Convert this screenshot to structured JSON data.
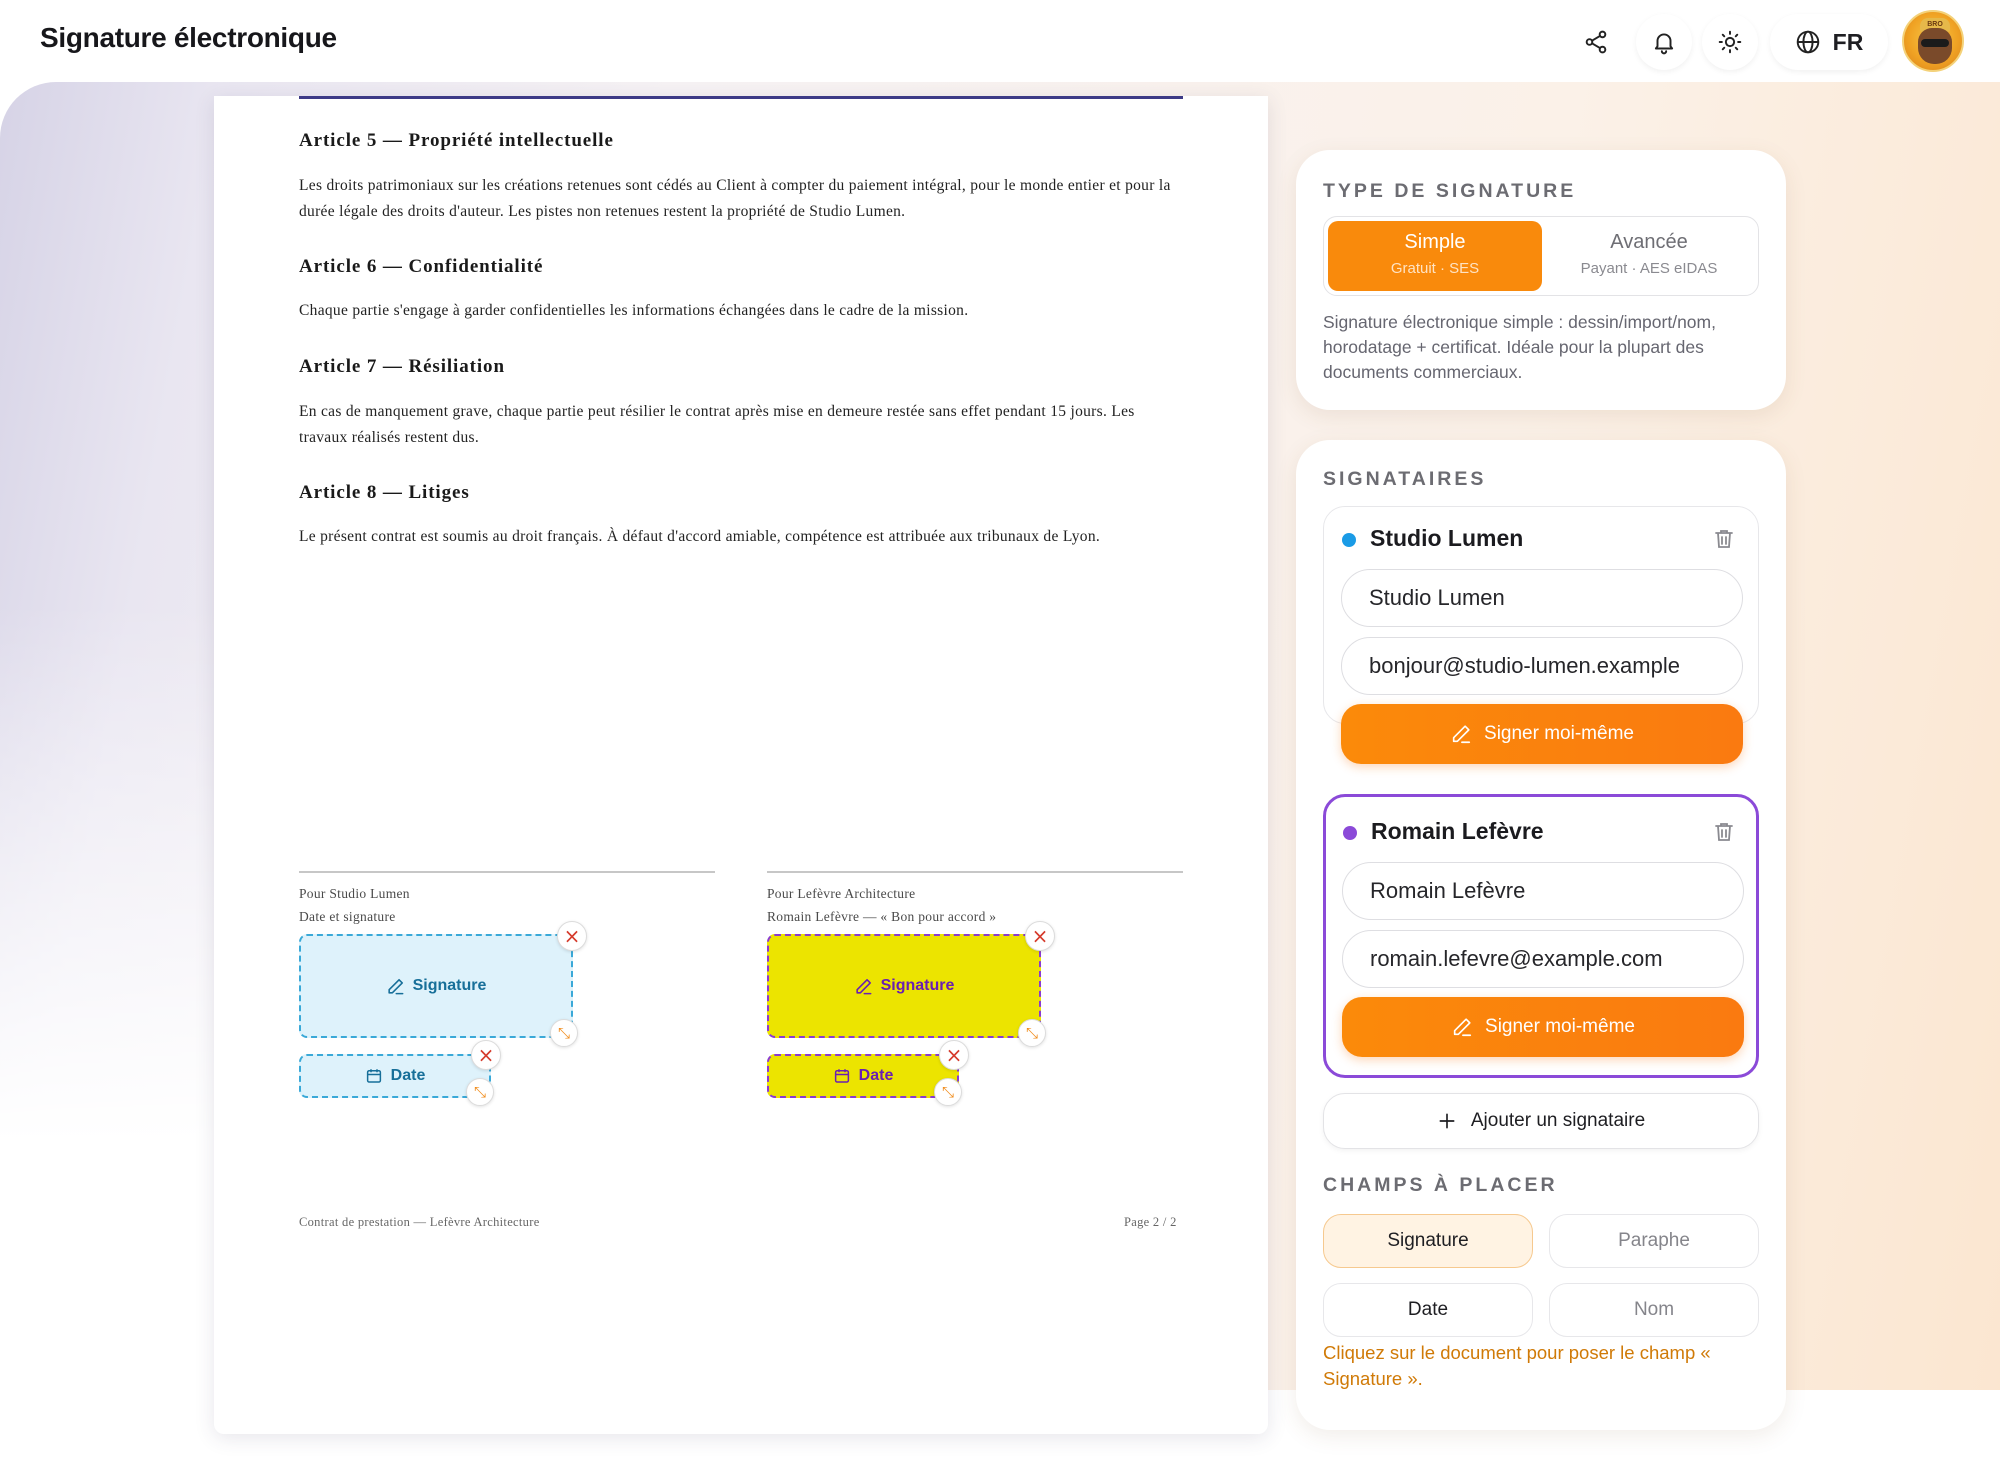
{
  "header": {
    "title": "Signature électronique",
    "language": "FR",
    "avatar_text": "BRO"
  },
  "document": {
    "articles": [
      {
        "title": "Article 5 — Propriété intellectuelle",
        "body": "Les droits patrimoniaux sur les créations retenues sont cédés au Client à compter du paiement intégral, pour le monde entier et pour la durée légale des droits d'auteur. Les pistes non retenues restent la propriété de Studio Lumen."
      },
      {
        "title": "Article 6 — Confidentialité",
        "body": "Chaque partie s'engage à garder confidentielles les informations échangées dans le cadre de la mission."
      },
      {
        "title": "Article 7 — Résiliation",
        "body": "En cas de manquement grave, chaque partie peut résilier le contrat après mise en demeure restée sans effet pendant 15 jours. Les travaux réalisés restent dus."
      },
      {
        "title": "Article 8 — Litiges",
        "body": "Le présent contrat est soumis au droit français. À défaut d'accord amiable, compétence est attribuée aux tribunaux de Lyon."
      }
    ],
    "signature_blocks": [
      {
        "line1": "Pour Studio Lumen",
        "line2": "Date et signature",
        "signature_label": "Signature",
        "date_label": "Date",
        "color": "#3aa9d8"
      },
      {
        "line1": "Pour Lefèvre Architecture",
        "line2": "Romain Lefèvre — « Bon pour accord »",
        "signature_label": "Signature",
        "date_label": "Date",
        "color": "#8a3bd0"
      }
    ],
    "footer_left": "Contrat de prestation — Lefèvre Architecture",
    "footer_right": "Page 2 / 2"
  },
  "signature_type": {
    "heading": "TYPE DE SIGNATURE",
    "options": [
      {
        "title": "Simple",
        "subtitle": "Gratuit · SES",
        "active": true
      },
      {
        "title": "Avancée",
        "subtitle": "Payant · AES eIDAS",
        "active": false
      }
    ],
    "description": "Signature électronique simple : dessin/import/nom, horodatage + certificat. Idéale pour la plupart des documents commerciaux."
  },
  "signers": {
    "heading": "SIGNATAIRES",
    "list": [
      {
        "name": "Studio Lumen",
        "name_value": "Studio Lumen",
        "email_value": "bonjour@studio-lumen.example",
        "button": "Signer moi-même",
        "color": "#1a9be6",
        "selected": false
      },
      {
        "name": "Romain Lefèvre",
        "name_value": "Romain Lefèvre",
        "email_value": "romain.lefevre@example.com",
        "button": "Signer moi-même",
        "color": "#8b4ad8",
        "selected": true
      }
    ],
    "add_label": "Ajouter un signataire"
  },
  "fields": {
    "heading": "CHAMPS À PLACER",
    "chips": [
      {
        "label": "Signature",
        "state": "selected"
      },
      {
        "label": "Paraphe",
        "state": "muted"
      },
      {
        "label": "Date",
        "state": "normal"
      },
      {
        "label": "Nom",
        "state": "muted"
      }
    ],
    "hint": "Cliquez sur le document pour poser le champ « Signature »."
  },
  "colors": {
    "accent": "#f98a0c",
    "selected_border": "#8b4ad8",
    "hint": "#d07a07"
  }
}
